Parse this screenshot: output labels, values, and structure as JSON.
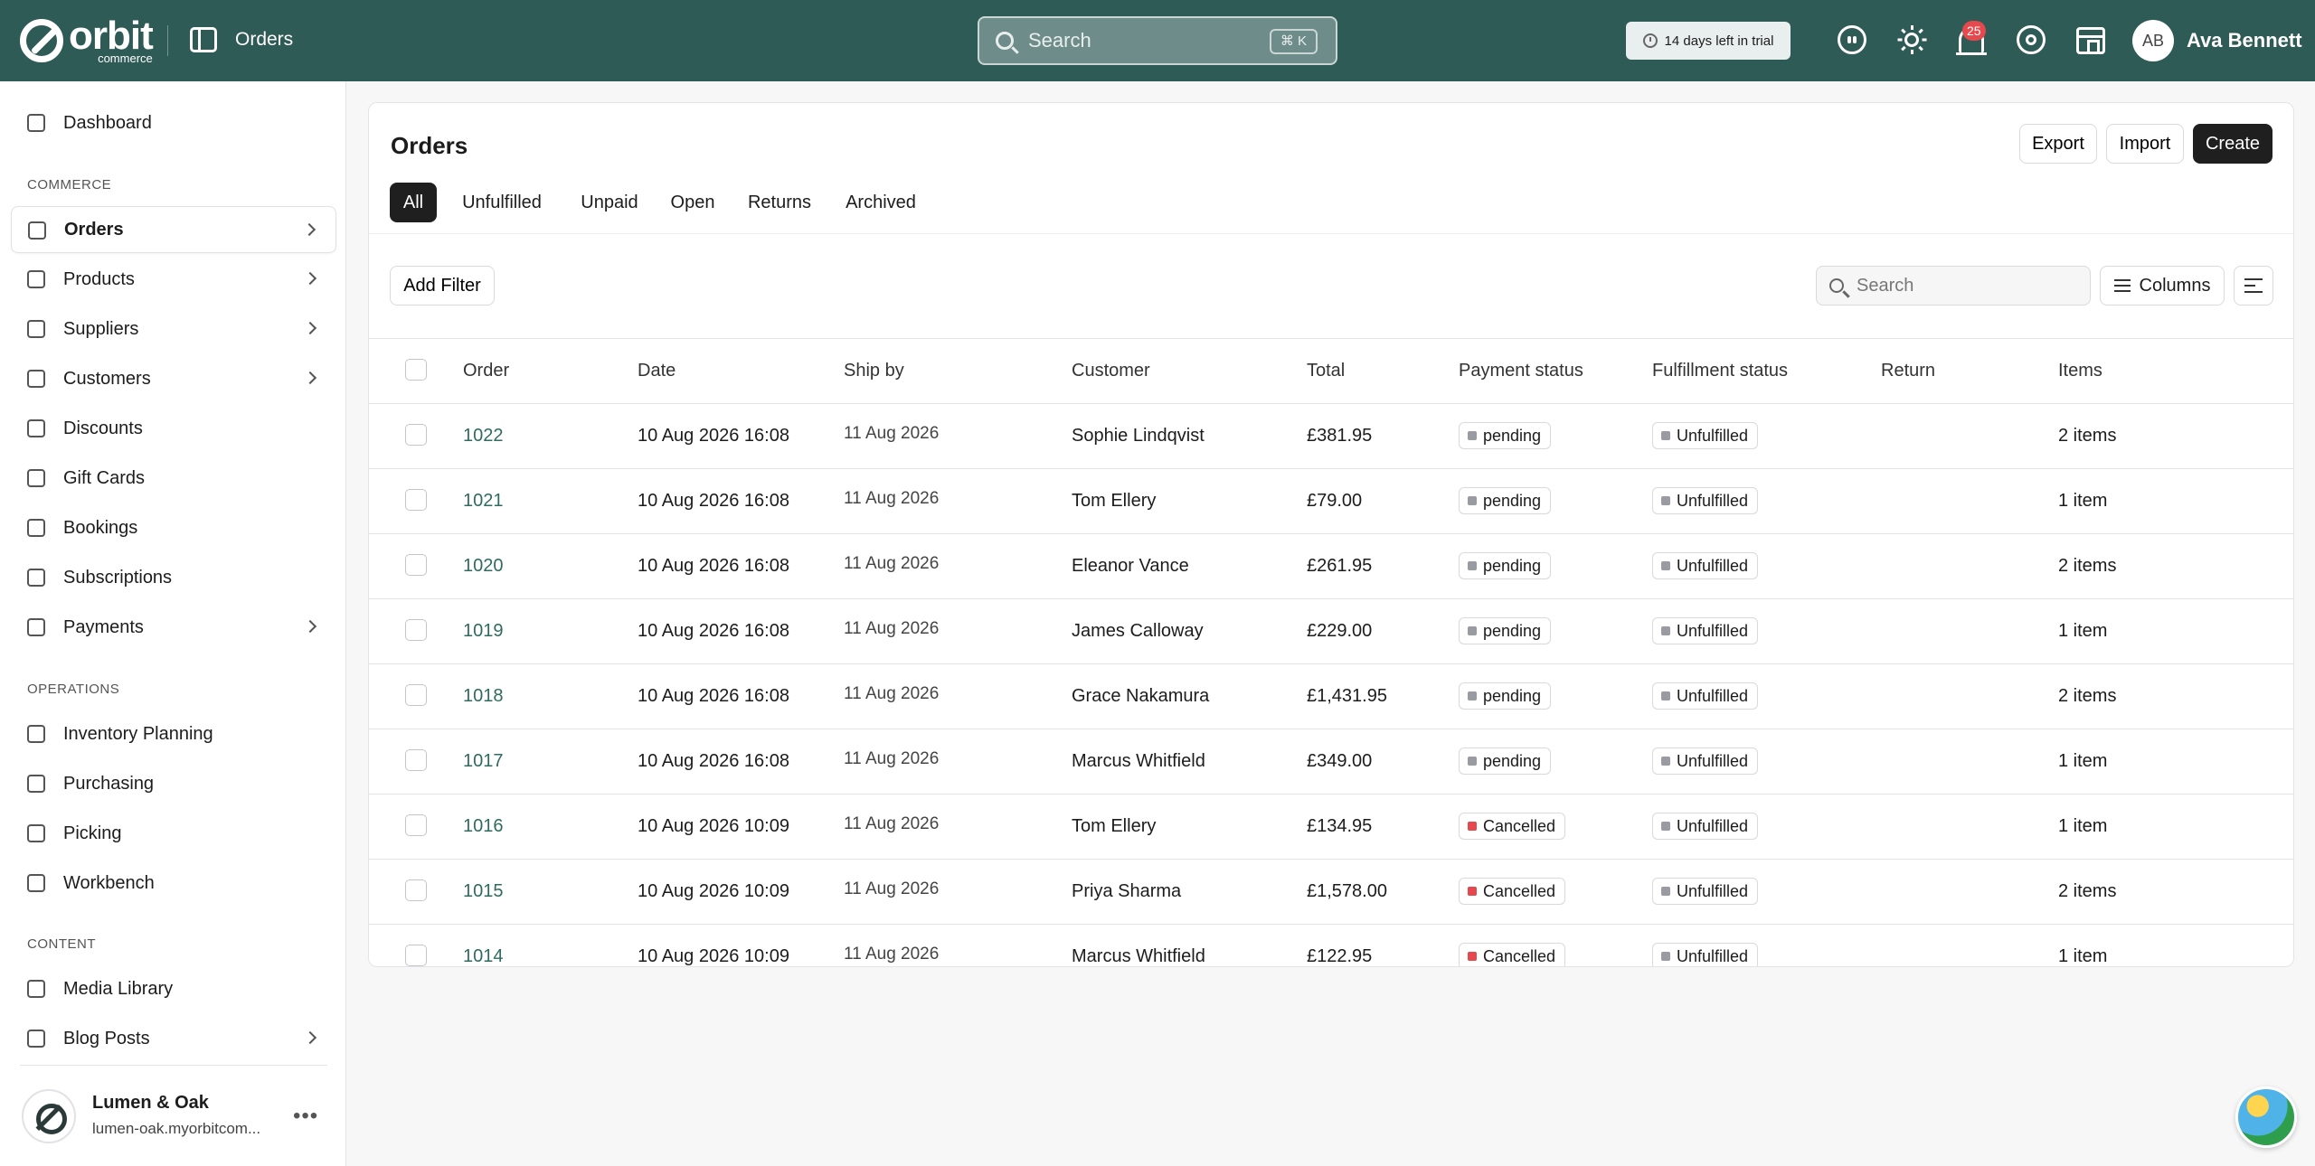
{
  "brand": {
    "name": "orbit",
    "sub": "commerce"
  },
  "topbar": {
    "section_title": "Orders",
    "search_placeholder": "Search",
    "search_shortcut": "⌘ K",
    "trial_text": "14 days left in trial",
    "notification_count": "25",
    "user_initials": "AB",
    "user_name": "Ava Bennett",
    "icons": [
      "discord-icon",
      "sun-icon",
      "bell-icon",
      "help-icon",
      "store-icon"
    ]
  },
  "sidebar": {
    "dashboard": "Dashboard",
    "commerce_heading": "COMMERCE",
    "commerce_items": [
      {
        "label": "Orders",
        "icon": "orders-icon",
        "chevron": true,
        "active": true
      },
      {
        "label": "Products",
        "icon": "products-icon",
        "chevron": true
      },
      {
        "label": "Suppliers",
        "icon": "suppliers-icon",
        "chevron": true
      },
      {
        "label": "Customers",
        "icon": "customers-icon",
        "chevron": true
      },
      {
        "label": "Discounts",
        "icon": "tag-icon",
        "chevron": false
      },
      {
        "label": "Gift Cards",
        "icon": "gift-icon",
        "chevron": false
      },
      {
        "label": "Bookings",
        "icon": "calendar-icon",
        "chevron": false
      },
      {
        "label": "Subscriptions",
        "icon": "refresh-icon",
        "chevron": false
      },
      {
        "label": "Payments",
        "icon": "card-icon",
        "chevron": true
      }
    ],
    "operations_heading": "OPERATIONS",
    "operations_items": [
      {
        "label": "Inventory Planning",
        "icon": "box-icon"
      },
      {
        "label": "Purchasing",
        "icon": "cart-icon"
      },
      {
        "label": "Picking",
        "icon": "pin-icon"
      },
      {
        "label": "Workbench",
        "icon": "cube-icon"
      }
    ],
    "content_heading": "CONTENT",
    "content_items": [
      {
        "label": "Media Library",
        "icon": "image-icon",
        "chevron": false
      },
      {
        "label": "Blog Posts",
        "icon": "blog-icon",
        "chevron": true
      }
    ],
    "store": {
      "name": "Lumen & Oak",
      "domain": "lumen-oak.myorbitcom..."
    }
  },
  "main": {
    "title": "Orders",
    "actions": {
      "export": "Export",
      "import": "Import",
      "create": "Create"
    },
    "tabs": [
      "All",
      "Unfulfilled",
      "Unpaid",
      "Open",
      "Returns",
      "Archived"
    ],
    "add_filter": "Add Filter",
    "table_search_placeholder": "Search",
    "columns_label": "Columns",
    "table": {
      "headers": [
        "Order",
        "Date",
        "Ship by",
        "Customer",
        "Total",
        "Payment status",
        "Fulfillment status",
        "Return",
        "Items"
      ],
      "rows": [
        {
          "order": "1022",
          "date": "10 Aug 2026 16:08",
          "ship_by": "11 Aug 2026",
          "customer": "Sophie Lindqvist",
          "total": "£381.95",
          "payment": "pending",
          "fulfillment": "Unfulfilled",
          "return": "",
          "items": "2 items"
        },
        {
          "order": "1021",
          "date": "10 Aug 2026 16:08",
          "ship_by": "11 Aug 2026",
          "customer": "Tom Ellery",
          "total": "£79.00",
          "payment": "pending",
          "fulfillment": "Unfulfilled",
          "return": "",
          "items": "1 item"
        },
        {
          "order": "1020",
          "date": "10 Aug 2026 16:08",
          "ship_by": "11 Aug 2026",
          "customer": "Eleanor Vance",
          "total": "£261.95",
          "payment": "pending",
          "fulfillment": "Unfulfilled",
          "return": "",
          "items": "2 items"
        },
        {
          "order": "1019",
          "date": "10 Aug 2026 16:08",
          "ship_by": "11 Aug 2026",
          "customer": "James Calloway",
          "total": "£229.00",
          "payment": "pending",
          "fulfillment": "Unfulfilled",
          "return": "",
          "items": "1 item"
        },
        {
          "order": "1018",
          "date": "10 Aug 2026 16:08",
          "ship_by": "11 Aug 2026",
          "customer": "Grace Nakamura",
          "total": "£1,431.95",
          "payment": "pending",
          "fulfillment": "Unfulfilled",
          "return": "",
          "items": "2 items"
        },
        {
          "order": "1017",
          "date": "10 Aug 2026 16:08",
          "ship_by": "11 Aug 2026",
          "customer": "Marcus Whitfield",
          "total": "£349.00",
          "payment": "pending",
          "fulfillment": "Unfulfilled",
          "return": "",
          "items": "1 item"
        },
        {
          "order": "1016",
          "date": "10 Aug 2026 10:09",
          "ship_by": "11 Aug 2026",
          "customer": "Tom Ellery",
          "total": "£134.95",
          "payment": "Cancelled",
          "fulfillment": "Unfulfilled",
          "return": "",
          "items": "1 item"
        },
        {
          "order": "1015",
          "date": "10 Aug 2026 10:09",
          "ship_by": "11 Aug 2026",
          "customer": "Priya Sharma",
          "total": "£1,578.00",
          "payment": "Cancelled",
          "fulfillment": "Unfulfilled",
          "return": "",
          "items": "2 items"
        },
        {
          "order": "1014",
          "date": "10 Aug 2026 10:09",
          "ship_by": "11 Aug 2026",
          "customer": "Marcus Whitfield",
          "total": "£122.95",
          "payment": "Cancelled",
          "fulfillment": "Unfulfilled",
          "return": "",
          "items": "1 item"
        }
      ]
    }
  },
  "colors": {
    "topbar": "#2f5b57",
    "order_link": "#2f6b5f",
    "pending_dot": "#9a9aa2",
    "cancelled_dot": "#e5484d",
    "unfulfilled_dot": "#9a9aa2",
    "primary_button": "#1f1f1f"
  }
}
